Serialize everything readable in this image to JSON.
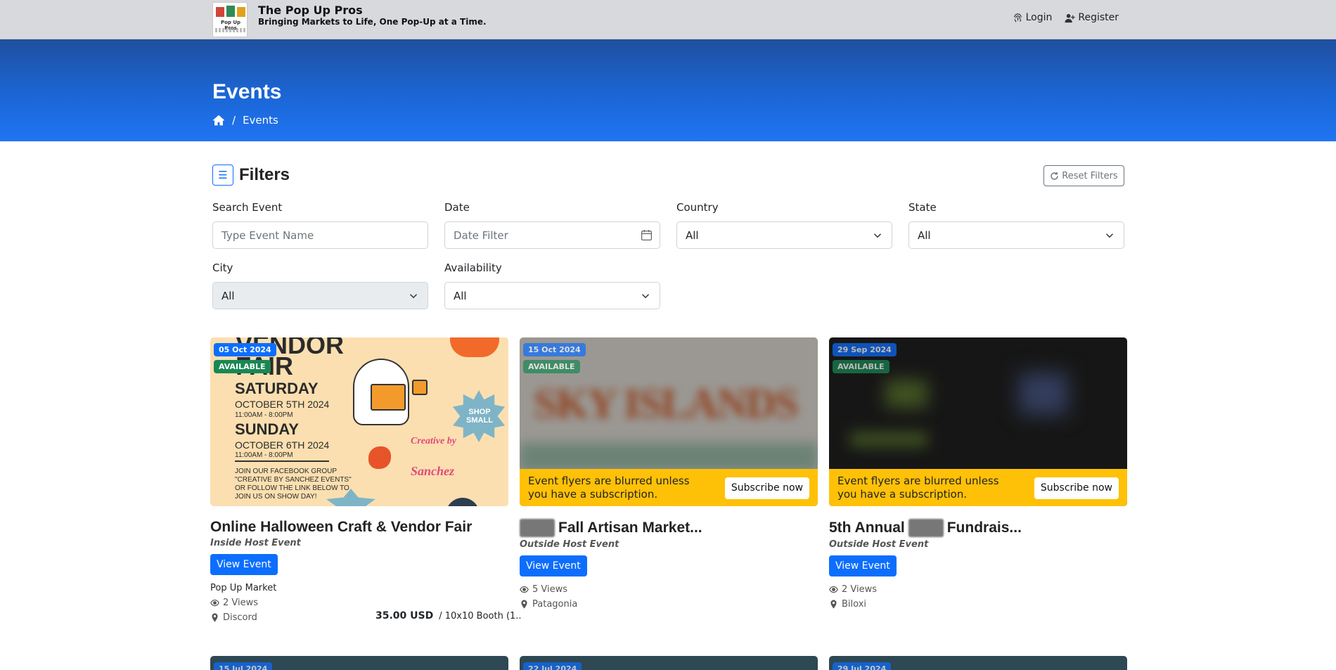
{
  "header": {
    "brand_title": "The Pop Up Pros",
    "brand_tagline": "Bringing Markets to Life, One Pop-Up at a Time.",
    "logo_text": "Pop Up Pros",
    "login_label": "Login",
    "register_label": "Register"
  },
  "hero": {
    "title": "Events",
    "breadcrumb_current": "Events"
  },
  "filters": {
    "title": "Filters",
    "reset_label": "Reset Filters",
    "search": {
      "label": "Search Event",
      "placeholder": "Type Event Name",
      "value": ""
    },
    "date": {
      "label": "Date",
      "placeholder": "Date Filter",
      "value": ""
    },
    "country": {
      "label": "Country",
      "value": "All"
    },
    "state": {
      "label": "State",
      "value": "All"
    },
    "city": {
      "label": "City",
      "value": "All"
    },
    "availability": {
      "label": "Availability",
      "value": "All"
    }
  },
  "subscription": {
    "message": "Event flyers are blurred unless you have a subscription.",
    "button": "Subscribe now"
  },
  "events": [
    {
      "date": "05 Oct 2024",
      "status": "AVAILABLE",
      "title": "Online Halloween Craft & Vendor Fair",
      "host_type": "Inside Host Event",
      "view_label": "View Event",
      "organizer": "Pop Up Market",
      "views": "2 Views",
      "location": "Discord",
      "price": "35.00 USD",
      "price_unit": "/ 10x10 Booth (1..",
      "flyer": {
        "line1": "VENDOR",
        "line2": "FAIR",
        "day1": "SATURDAY",
        "date1": "OCTOBER 5TH 2024",
        "time1": "11:00AM - 8:00PM",
        "day2": "SUNDAY",
        "date2": "OCTOBER 6TH 2024",
        "time2": "11:00AM - 8:00PM",
        "join1": "JOIN OUR FACEBOOK GROUP",
        "join2": "\"CREATIVE BY SANCHEZ EVENTS\"",
        "join3": "OR FOLLOW THE LINK BELOW TO",
        "join4": "JOIN US ON SHOW DAY!",
        "shop": "SHOP SMALL",
        "creative": "Creative by",
        "sanchez": "Sanchez"
      }
    },
    {
      "date": "15 Oct 2024",
      "status": "AVAILABLE",
      "title": "Fall Artisan Market...",
      "host_type": "Outside Host Event",
      "view_label": "View Event",
      "views": "5 Views",
      "location": "Patagonia",
      "flyer_text": "SKY ISLANDS"
    },
    {
      "date": "29 Sep 2024",
      "status": "AVAILABLE",
      "title_prefix": "5th Annual",
      "title": "Fundrais...",
      "host_type": "Outside Host Event",
      "view_label": "View Event",
      "views": "2 Views",
      "location": "Biloxi"
    }
  ],
  "next_row_dates": [
    "15 Jul 2024",
    "22 Jul 2024",
    "29 Jul 2024"
  ]
}
